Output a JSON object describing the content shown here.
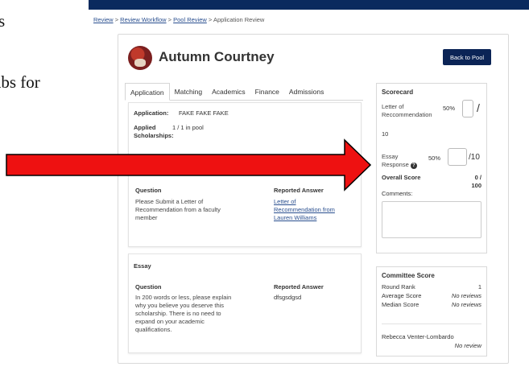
{
  "left_text": [
    "s",
    "abs for"
  ],
  "breadcrumb": {
    "items": [
      "Review",
      "Review Workflow",
      "Pool Review",
      "Application Review"
    ],
    "separator": ">"
  },
  "applicant": {
    "name": "Autumn Courtney"
  },
  "back_button": "Back to Pool",
  "tabs": [
    "Application",
    "Matching",
    "Academics",
    "Finance",
    "Admissions"
  ],
  "application_card": {
    "application_label": "Application:",
    "application_value": "FAKE FAKE FAKE",
    "applied_label_line1": "Applied",
    "applied_label_line2": "Scholarships:",
    "applied_value": "1 / 1 in pool",
    "question_header": "Question",
    "answer_header": "Reported Answer",
    "question_lines": [
      "Please Submit a Letter of",
      "Recommendation from a faculty",
      "member"
    ],
    "answer_lines": [
      "Letter of",
      "Recommendation from",
      "Lauren Williams"
    ]
  },
  "essay_card": {
    "title": "Essay",
    "question_header": "Question",
    "answer_header": "Reported Answer",
    "question_lines": [
      "In 200 words or less, please explain",
      "why you believe you deserve this",
      "scholarship. There is no need to",
      "expand on your academic",
      "qualifications."
    ],
    "answer": "dfsgsdgsd"
  },
  "scorecard": {
    "title": "Scorecard",
    "rec_label_line1": "Letter of",
    "rec_label_line2": "Reccommendation",
    "rec_weight": "50%",
    "rec_slash": "/",
    "rec_max": "10",
    "essay_label_line1": "Essay",
    "essay_label_line2": "Response",
    "essay_weight": "50%",
    "essay_max": "/10",
    "overall_label": "Overall Score",
    "overall_value_line1": "0 /",
    "overall_value_line2": "100",
    "comments_label": "Comments:"
  },
  "committee": {
    "title": "Committee Score",
    "round_rank_label": "Round Rank",
    "round_rank_value": "1",
    "average_label": "Average Score",
    "average_value": "No reviews",
    "median_label": "Median Score",
    "median_value": "No reviews",
    "reviewer_name": "Rebecca Venter-Lombardo",
    "reviewer_status": "No review"
  },
  "colors": {
    "topbar": "#0a2a5e",
    "button": "#0b2456",
    "arrow_fill": "#ee1111",
    "link": "#2a4f8f"
  },
  "icons": {
    "help": "question-circle-icon",
    "arrow": "red-arrow-annotation"
  }
}
